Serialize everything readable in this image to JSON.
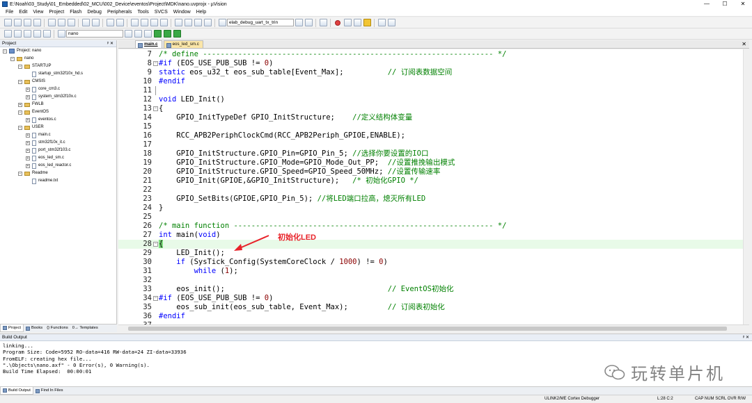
{
  "window": {
    "title": "E:\\Noah\\03_Study\\01_Embedded\\02_MCU\\002_Device\\eventos\\Project\\MDK\\nano.uvprojx - µVision",
    "controls": [
      "—",
      "☐",
      "✕"
    ]
  },
  "menu": [
    "File",
    "Edit",
    "View",
    "Project",
    "Flash",
    "Debug",
    "Peripherals",
    "Tools",
    "SVCS",
    "Window",
    "Help"
  ],
  "toolbar": {
    "debug_target": "elab_debug_uart_tx_trin",
    "target_select": "nano"
  },
  "project_panel": {
    "title": "Project",
    "pin": "ᵖ ✕",
    "tree": [
      {
        "level": 0,
        "kind": "proj",
        "label": "Project: nano",
        "exp": "−"
      },
      {
        "level": 1,
        "kind": "folder",
        "label": "nano",
        "exp": "−"
      },
      {
        "level": 2,
        "kind": "folder",
        "label": "STARTUP",
        "exp": "−"
      },
      {
        "level": 3,
        "kind": "file",
        "label": "startup_stm32f10x_hd.s",
        "exp": ""
      },
      {
        "level": 2,
        "kind": "folder",
        "label": "CMSIS",
        "exp": "−"
      },
      {
        "level": 3,
        "kind": "file",
        "label": "core_cm3.c",
        "exp": "+"
      },
      {
        "level": 3,
        "kind": "file",
        "label": "system_stm32f10x.c",
        "exp": "+"
      },
      {
        "level": 2,
        "kind": "folder",
        "label": "FWLB",
        "exp": "+"
      },
      {
        "level": 2,
        "kind": "folder",
        "label": "EventOS",
        "exp": "−"
      },
      {
        "level": 3,
        "kind": "file",
        "label": "eventos.c",
        "exp": "+"
      },
      {
        "level": 2,
        "kind": "folder",
        "label": "USER",
        "exp": "−"
      },
      {
        "level": 3,
        "kind": "file",
        "label": "main.c",
        "exp": "+"
      },
      {
        "level": 3,
        "kind": "file",
        "label": "stm32f10x_it.c",
        "exp": "+"
      },
      {
        "level": 3,
        "kind": "file",
        "label": "port_stm32f103.c",
        "exp": "+"
      },
      {
        "level": 3,
        "kind": "file",
        "label": "eos_led_sm.c",
        "exp": "+"
      },
      {
        "level": 3,
        "kind": "file",
        "label": "eos_led_reactor.c",
        "exp": "+"
      },
      {
        "level": 2,
        "kind": "folder",
        "label": "Readme",
        "exp": "−"
      },
      {
        "level": 3,
        "kind": "file",
        "label": "readme.txt",
        "exp": ""
      }
    ],
    "tabs": [
      "Project",
      "Books",
      "{} Functions",
      "0→ Templates"
    ]
  },
  "editor": {
    "tabs": [
      "main.c",
      "eos_led_sm.c"
    ],
    "close": "✕",
    "lines": [
      {
        "n": "7",
        "fold": "",
        "tokens": [
          [
            "cm",
            "/* define ------------------------------------------------------------------ */"
          ]
        ]
      },
      {
        "n": "8",
        "fold": "−",
        "tokens": [
          [
            "pp",
            "#if"
          ],
          [
            "",
            " (EOS_USE_PUB_SUB != "
          ],
          [
            "num",
            "0"
          ],
          [
            "",
            ")"
          ]
        ]
      },
      {
        "n": "9",
        "fold": "",
        "tokens": [
          [
            "kw",
            "static"
          ],
          [
            "",
            " eos_u32_t eos_sub_table[Event_Max];          "
          ],
          [
            "cm",
            "// 订阅表数据空间"
          ]
        ]
      },
      {
        "n": "10",
        "fold": "",
        "tokens": [
          [
            "pp",
            "#endif"
          ]
        ]
      },
      {
        "n": "11",
        "fold": "bar",
        "tokens": []
      },
      {
        "n": "12",
        "fold": "",
        "tokens": [
          [
            "kw",
            "void"
          ],
          [
            "",
            " LED_Init()"
          ]
        ]
      },
      {
        "n": "13",
        "fold": "−",
        "tokens": [
          [
            "",
            "{"
          ]
        ]
      },
      {
        "n": "14",
        "fold": "",
        "tokens": [
          [
            "",
            "    GPIO_InitTypeDef GPIO_InitStructure;    "
          ],
          [
            "cm",
            "//定义结构体变量"
          ]
        ]
      },
      {
        "n": "15",
        "fold": "",
        "tokens": []
      },
      {
        "n": "16",
        "fold": "",
        "tokens": [
          [
            "",
            "    RCC_APB2PeriphClockCmd(RCC_APB2Periph_GPIOE,ENABLE);"
          ]
        ]
      },
      {
        "n": "17",
        "fold": "",
        "tokens": []
      },
      {
        "n": "18",
        "fold": "",
        "tokens": [
          [
            "",
            "    GPIO_InitStructure.GPIO_Pin=GPIO_Pin_5; "
          ],
          [
            "cm",
            "//选择你要设置的IO口"
          ]
        ]
      },
      {
        "n": "19",
        "fold": "",
        "tokens": [
          [
            "",
            "    GPIO_InitStructure.GPIO_Mode=GPIO_Mode_Out_PP;  "
          ],
          [
            "cm",
            "//设置推挽输出模式"
          ]
        ]
      },
      {
        "n": "20",
        "fold": "",
        "tokens": [
          [
            "",
            "    GPIO_InitStructure.GPIO_Speed=GPIO_Speed_50MHz; "
          ],
          [
            "cm",
            "//设置传输速率"
          ]
        ]
      },
      {
        "n": "21",
        "fold": "",
        "tokens": [
          [
            "",
            "    GPIO_Init(GPIOE,&GPIO_InitStructure);   "
          ],
          [
            "cm",
            "/* 初始化GPIO */"
          ]
        ]
      },
      {
        "n": "22",
        "fold": "",
        "tokens": []
      },
      {
        "n": "23",
        "fold": "",
        "tokens": [
          [
            "",
            "    GPIO_SetBits(GPIOE,GPIO_Pin_5); "
          ],
          [
            "cm",
            "//将LED端口拉高，熄灭所有LED"
          ]
        ]
      },
      {
        "n": "24",
        "fold": "",
        "tokens": [
          [
            "",
            "}"
          ]
        ]
      },
      {
        "n": "25",
        "fold": "",
        "tokens": []
      },
      {
        "n": "26",
        "fold": "",
        "tokens": [
          [
            "cm",
            "/* main function ----------------------------------------------------------- */"
          ]
        ]
      },
      {
        "n": "27",
        "fold": "",
        "tokens": [
          [
            "kw",
            "int"
          ],
          [
            "",
            " main("
          ],
          [
            "kw",
            "void"
          ],
          [
            "",
            ")"
          ]
        ]
      },
      {
        "n": "28",
        "fold": "−",
        "hl": true,
        "tokens": [
          [
            "brace",
            "{"
          ]
        ]
      },
      {
        "n": "29",
        "fold": "",
        "tokens": [
          [
            "",
            "    LED_Init();"
          ]
        ]
      },
      {
        "n": "30",
        "fold": "",
        "tokens": [
          [
            "",
            "    "
          ],
          [
            "kw",
            "if"
          ],
          [
            "",
            " (SysTick_Config(SystemCoreClock / "
          ],
          [
            "num",
            "1000"
          ],
          [
            "",
            ") != "
          ],
          [
            "num",
            "0"
          ],
          [
            "",
            ")"
          ]
        ]
      },
      {
        "n": "31",
        "fold": "",
        "tokens": [
          [
            "",
            "        "
          ],
          [
            "kw",
            "while"
          ],
          [
            "",
            " ("
          ],
          [
            "num",
            "1"
          ],
          [
            "",
            ");"
          ]
        ]
      },
      {
        "n": "32",
        "fold": "",
        "tokens": []
      },
      {
        "n": "33",
        "fold": "",
        "tokens": [
          [
            "",
            "    eos_init();                                     "
          ],
          [
            "cm",
            "// EventOS初始化"
          ]
        ]
      },
      {
        "n": "34",
        "fold": "−",
        "tokens": [
          [
            "pp",
            "#if"
          ],
          [
            "",
            " (EOS_USE_PUB_SUB != "
          ],
          [
            "num",
            "0"
          ],
          [
            "",
            ")"
          ]
        ]
      },
      {
        "n": "35",
        "fold": "",
        "tokens": [
          [
            "",
            "    eos_sub_init(eos_sub_table, Event_Max);         "
          ],
          [
            "cm",
            "// 订阅表初始化"
          ]
        ]
      },
      {
        "n": "36",
        "fold": "",
        "tokens": [
          [
            "pp",
            "#endif"
          ]
        ]
      },
      {
        "n": "37",
        "fold": "",
        "tokens": []
      }
    ]
  },
  "annotation": {
    "text": "初始化LED",
    "color": "#e8232a"
  },
  "build_output": {
    "title": "Build Output",
    "pin": "ᵖ ✕",
    "text": "linking...\nProgram Size: Code=5952 RO-data=416 RW-data=24 ZI-data=33936\nFromELF: creating hex file...\n\".\\Objects\\nano.axf\" - 0 Error(s), 0 Warning(s).\nBuild Time Elapsed:  00:00:01",
    "tabs": [
      "Build Output",
      "Find In Files"
    ]
  },
  "watermark": {
    "text": "玩转单片机"
  },
  "status": {
    "debugger": "ULINK2/ME Cortex Debugger",
    "position": "L:28 C:2",
    "flags": "CAP  NUM  SCRL  OVR  R/W"
  }
}
